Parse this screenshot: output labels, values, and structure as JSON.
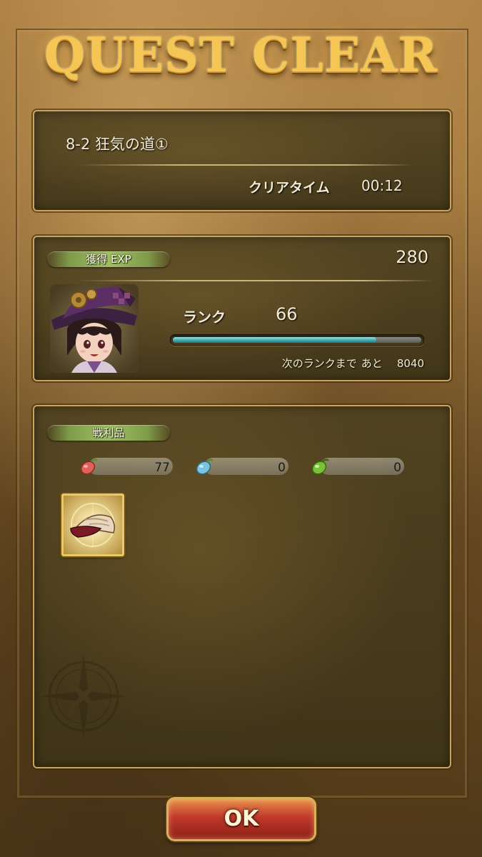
{
  "header": {
    "title": "QUEST CLEAR"
  },
  "quest": {
    "name": "8-2 狂気の道①",
    "clear_time_label": "クリアタイム",
    "clear_time_value": "00:12"
  },
  "exp": {
    "tag": "獲得 EXP",
    "value": "280",
    "rank_label": "ランク",
    "rank_value": "66",
    "rank_progress": 0.82,
    "next_rank_label": "次のランクまで",
    "next_rank_prefix": "あと",
    "next_rank_value": "8040"
  },
  "loot": {
    "tag": "戦利品",
    "counters": [
      {
        "icon": "red-seed-icon",
        "color": "#e0605a",
        "value": "77"
      },
      {
        "icon": "blue-seed-icon",
        "color": "#7cc3e0",
        "value": "0"
      },
      {
        "icon": "green-seed-icon",
        "color": "#7bc23a",
        "value": "0"
      }
    ],
    "items": [
      {
        "icon": "hat-item-icon"
      }
    ]
  },
  "footer": {
    "ok_label": "OK"
  },
  "colors": {
    "accent_gold": "#f6c654",
    "panel_border": "#c9a45a",
    "exp_bar": "#3aa5aa",
    "ok_button": "#c0392b"
  }
}
